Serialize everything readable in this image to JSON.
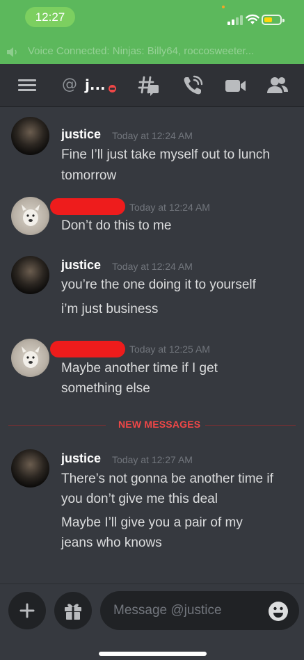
{
  "status_bar": {
    "time": "12:27"
  },
  "voice_banner": {
    "text": "Voice Connected: Ninjas: Billy64, roccosweeter..."
  },
  "toolbar": {
    "at": "@",
    "channel": "j..."
  },
  "messages": [
    {
      "author": "justice",
      "timestamp": "Today at 12:24 AM",
      "lines": [
        "Fine I’ll just take myself out to lunch",
        "tomorrow"
      ]
    },
    {
      "author": "",
      "timestamp": "Today at 12:24 AM",
      "lines": [
        "Don’t do this to me"
      ]
    },
    {
      "author": "justice",
      "timestamp": "Today at 12:24 AM",
      "lines": [
        "you’re the one doing it to yourself",
        "i’m just business"
      ]
    },
    {
      "author": "",
      "timestamp": "Today at 12:25 AM",
      "lines": [
        "Maybe another time if I get",
        "something else"
      ]
    },
    {
      "author": "justice",
      "timestamp": "Today at 12:27 AM",
      "lines": [
        "There’s not gonna be another time if",
        "you don’t give me this deal",
        "Maybe I’ll give you a pair of my",
        "jeans who knows"
      ]
    }
  ],
  "divider": {
    "label": "NEW MESSAGES"
  },
  "composer": {
    "placeholder": "Message @justice"
  },
  "colors": {
    "accent_red": "#f04747",
    "banner_green": "#5cb85c",
    "background": "#36393f"
  },
  "icons": [
    "hamburger-icon",
    "hashtag-threads-icon",
    "phone-call-icon",
    "video-camera-icon",
    "members-icon",
    "plus-icon",
    "gift-icon",
    "emoji-icon"
  ]
}
